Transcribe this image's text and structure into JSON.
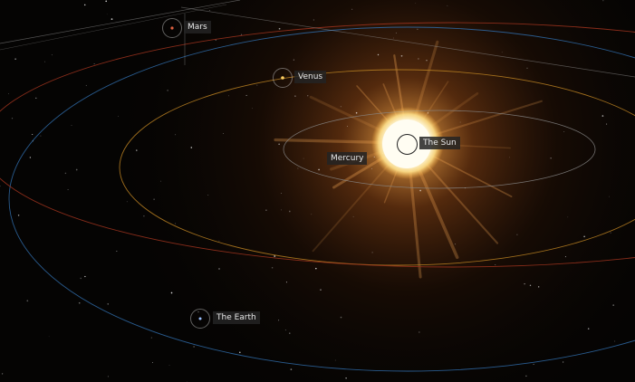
{
  "bodies": {
    "sun": {
      "label": "The Sun"
    },
    "mercury": {
      "label": "Mercury"
    },
    "venus": {
      "label": "Venus"
    },
    "earth": {
      "label": "The Earth"
    },
    "mars": {
      "label": "Mars"
    }
  },
  "colors": {
    "background": "#050403",
    "sun_glow": "#ff9a2e",
    "mercury_orbit": "#8a8a8a",
    "venus_orbit": "#b07a20",
    "earth_orbit": "#2f6aa6",
    "mars_orbit": "#a0341e",
    "label_bg": "#232323",
    "label_text": "#e8e8e8"
  }
}
